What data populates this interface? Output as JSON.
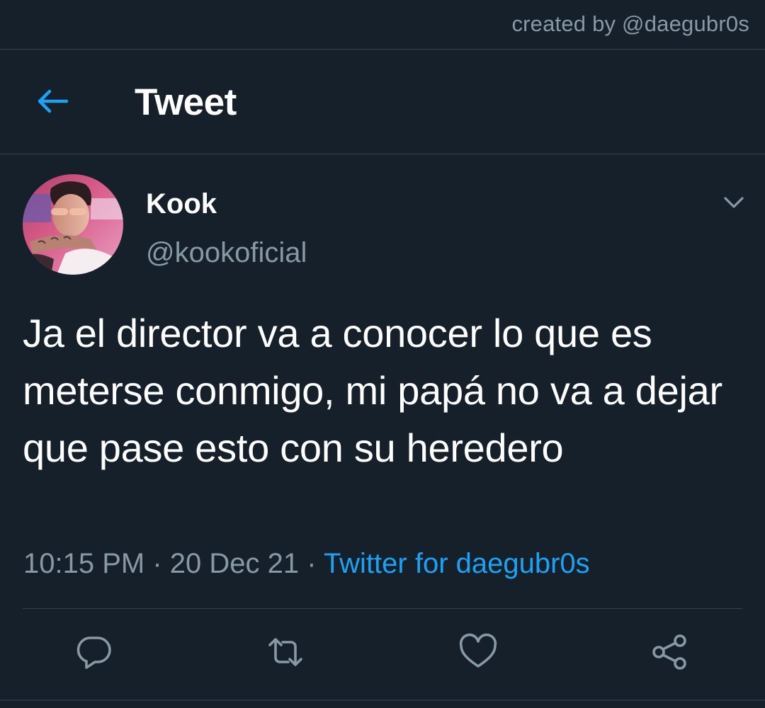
{
  "watermark": "created by @daegubr0s",
  "header": {
    "title": "Tweet",
    "back_icon": "arrow-left-icon"
  },
  "tweet": {
    "display_name": "Kook",
    "handle": "@kookoficial",
    "text": "Ja el director va a conocer lo que es meterse conmigo, mi papá no va a dejar que pase esto con su heredero",
    "time": "10:15 PM",
    "separator": " · ",
    "date": "20 Dec 21",
    "source": "Twitter for daegubr0s",
    "menu_icon": "chevron-down-icon"
  },
  "actions": [
    {
      "name": "reply",
      "icon": "reply-icon"
    },
    {
      "name": "retweet",
      "icon": "retweet-icon"
    },
    {
      "name": "like",
      "icon": "heart-icon"
    },
    {
      "name": "share",
      "icon": "share-icon"
    }
  ],
  "colors": {
    "background": "#15202b",
    "accent": "#1da1f2",
    "secondary_text": "#8899a6",
    "divider": "#38444d"
  }
}
